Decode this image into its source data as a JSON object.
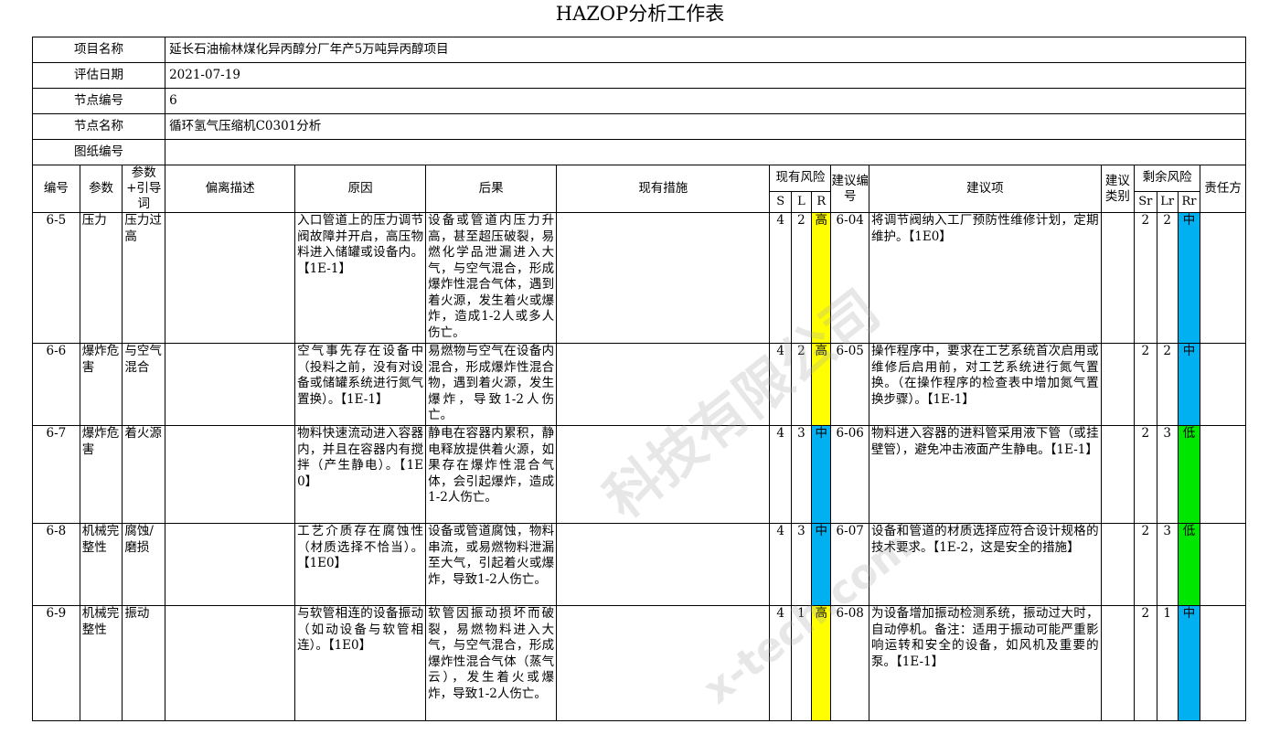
{
  "title": "HAZOP分析工作表",
  "info": {
    "project_label": "项目名称",
    "project_value": "延长石油榆林煤化异丙醇分厂年产5万吨异丙醇项目",
    "date_label": "评估日期",
    "date_value": "2021-07-19",
    "node_no_label": "节点编号",
    "node_no_value": "6",
    "node_name_label": "节点名称",
    "node_name_value": "循环氢气压缩机C0301分析",
    "drawing_label": "图纸编号",
    "drawing_value": ""
  },
  "headers": {
    "no": "编号",
    "param": "参数",
    "guide": "参数+引导词",
    "deviation": "偏离描述",
    "cause": "原因",
    "consequence": "后果",
    "measures": "现有措施",
    "current_risk": "现有风险",
    "s": "S",
    "l": "L",
    "r": "R",
    "rec_no": "建议编号",
    "recommendation": "建议项",
    "rec_type": "建议类别",
    "residual_risk": "剩余风险",
    "sr": "Sr",
    "lr": "Lr",
    "rr": "Rr",
    "owner": "责任方"
  },
  "rows": [
    {
      "no": "6-5",
      "param": "压力",
      "guide": "压力过高",
      "deviation": "",
      "cause": "入口管道上的压力调节阀故障并开启，高压物料进入储罐或设备内。【1E-1】",
      "consequence": "设备或管道内压力升高，甚至超压破裂，易燃化学品泄漏进入大气，与空气混合，形成爆炸性混合气体，遇到着火源，发生着火或爆炸，造成1-2人或多人伤亡。",
      "measures": "",
      "s": "4",
      "l": "2",
      "r": "高",
      "rec_no": "6-04",
      "recommendation": "将调节阀纳入工厂预防性维修计划，定期维护。【1E0】",
      "rec_type": "",
      "sr": "2",
      "lr": "2",
      "rr": "中",
      "owner": ""
    },
    {
      "no": "6-6",
      "param": "爆炸危害",
      "guide": "与空气混合",
      "deviation": "",
      "cause": "空气事先存在设备中（投料之前，没有对设备或储罐系统进行氮气置换）。【1E-1】",
      "consequence": "易燃物与空气在设备内混合，形成爆炸性混合物，遇到着火源，发生爆炸，导致1-2人伤亡。",
      "measures": "",
      "s": "4",
      "l": "2",
      "r": "高",
      "rec_no": "6-05",
      "recommendation": "操作程序中，要求在工艺系统首次启用或维修后启用前，对工艺系统进行氮气置换。（在操作程序的检查表中增加氮气置换步骤）。【1E-1】",
      "rec_type": "",
      "sr": "2",
      "lr": "2",
      "rr": "中",
      "owner": ""
    },
    {
      "no": "6-7",
      "param": "爆炸危害",
      "guide": "着火源",
      "deviation": "",
      "cause": "物料快速流动进入容器内，并且在容器内有搅拌（产生静电）。【1E0】",
      "consequence": "静电在容器内累积，静电释放提供着火源，如果存在爆炸性混合气体，会引起爆炸，造成1-2人伤亡。",
      "measures": "",
      "s": "4",
      "l": "3",
      "r": "中",
      "rec_no": "6-06",
      "recommendation": "物料进入容器的进料管采用液下管（或挂壁管），避免冲击液面产生静电。【1E-1】",
      "rec_type": "",
      "sr": "2",
      "lr": "3",
      "rr": "低",
      "owner": ""
    },
    {
      "no": "6-8",
      "param": "机械完整性",
      "guide": "腐蚀/磨损",
      "deviation": "",
      "cause": "工艺介质存在腐蚀性（材质选择不恰当）。【1E0】",
      "consequence": "设备或管道腐蚀，物料串流，或易燃物料泄漏至大气，引起着火或爆炸，导致1-2人伤亡。",
      "measures": "",
      "s": "4",
      "l": "3",
      "r": "中",
      "rec_no": "6-07",
      "recommendation": "设备和管道的材质选择应符合设计规格的技术要求。【1E-2，这是安全的措施】",
      "rec_type": "",
      "sr": "2",
      "lr": "3",
      "rr": "低",
      "owner": ""
    },
    {
      "no": "6-9",
      "param": "机械完整性",
      "guide": "振动",
      "deviation": "",
      "cause": "与软管相连的设备振动（如动设备与软管相连）。【1E0】",
      "consequence": "软管因振动损坏而破裂，易燃物料进入大气，与空气混合，形成爆炸性混合气体（蒸气云），发生着火或爆炸，导致1-2人伤亡。",
      "measures": "",
      "s": "4",
      "l": "1",
      "r": "高",
      "rec_no": "6-08",
      "recommendation": "为设备增加振动检测系统，振动过大时，自动停机。备注：适用于振动可能严重影响运转和安全的设备，如风机及重要的泵。【1E-1】",
      "rec_type": "",
      "sr": "2",
      "lr": "1",
      "rr": "中",
      "owner": ""
    }
  ],
  "colors": {
    "high": "#ffff00",
    "medium": "#00b0f0",
    "low": "#00e600"
  }
}
